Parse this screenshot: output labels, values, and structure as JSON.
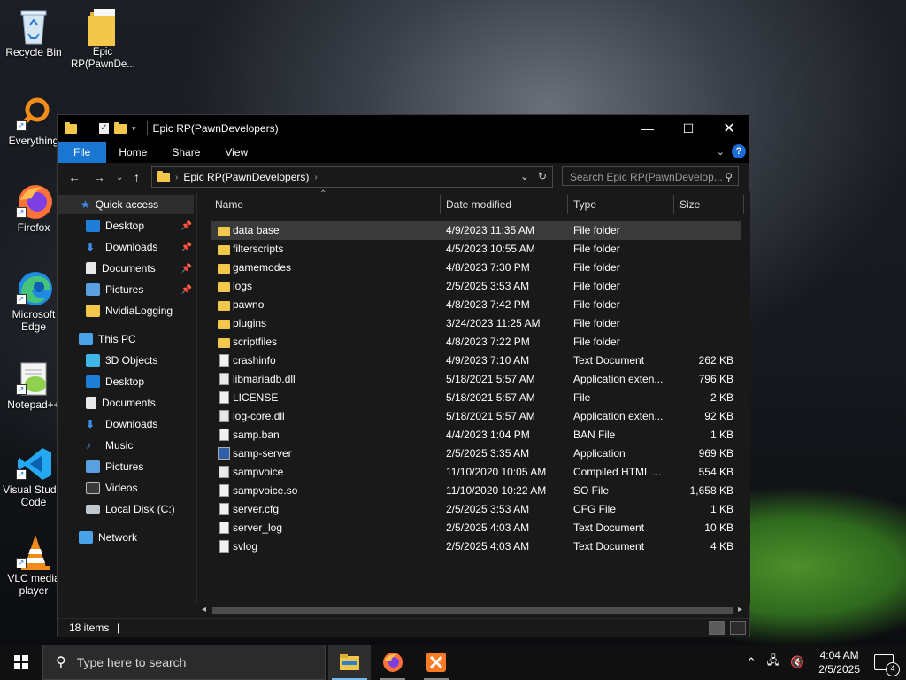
{
  "desktop": {
    "icons": [
      {
        "label": "Recycle Bin"
      },
      {
        "label": "Epic RP(PawnDe..."
      },
      {
        "label": "Everything"
      },
      {
        "label": "Firefox"
      },
      {
        "label": "Microsoft Edge"
      },
      {
        "label": "Notepad++"
      },
      {
        "label": "Visual Studio Code"
      },
      {
        "label": "VLC media player"
      }
    ]
  },
  "window": {
    "title": "Epic RP(PawnDevelopers)",
    "controls": {
      "minimize": "—",
      "maximize": "☐",
      "close": "✕"
    },
    "ribbon": {
      "file": "File",
      "home": "Home",
      "share": "Share",
      "view": "View",
      "help": "?"
    },
    "address": {
      "path": "Epic RP(PawnDevelopers)"
    },
    "search": {
      "placeholder": "Search Epic RP(PawnDevelop..."
    },
    "nav": [
      {
        "label": "Quick access",
        "pinned": false
      },
      {
        "label": "Desktop",
        "pinned": true
      },
      {
        "label": "Downloads",
        "pinned": true
      },
      {
        "label": "Documents",
        "pinned": true
      },
      {
        "label": "Pictures",
        "pinned": true
      },
      {
        "label": "NvidiaLogging",
        "pinned": false
      },
      {
        "label": "This PC",
        "pinned": false
      },
      {
        "label": "3D Objects",
        "pinned": false
      },
      {
        "label": "Desktop",
        "pinned": false
      },
      {
        "label": "Documents",
        "pinned": false
      },
      {
        "label": "Downloads",
        "pinned": false
      },
      {
        "label": "Music",
        "pinned": false
      },
      {
        "label": "Pictures",
        "pinned": false
      },
      {
        "label": "Videos",
        "pinned": false
      },
      {
        "label": "Local Disk (C:)",
        "pinned": false
      },
      {
        "label": "Network",
        "pinned": false
      }
    ],
    "columns": {
      "name": "Name",
      "date": "Date modified",
      "type": "Type",
      "size": "Size"
    },
    "files": [
      {
        "name": "data base",
        "date": "4/9/2023 11:35 AM",
        "type": "File folder",
        "size": "",
        "icon": "folder"
      },
      {
        "name": "filterscripts",
        "date": "4/5/2023 10:55 AM",
        "type": "File folder",
        "size": "",
        "icon": "folder"
      },
      {
        "name": "gamemodes",
        "date": "4/8/2023 7:30 PM",
        "type": "File folder",
        "size": "",
        "icon": "folder"
      },
      {
        "name": "logs",
        "date": "2/5/2025 3:53 AM",
        "type": "File folder",
        "size": "",
        "icon": "folder"
      },
      {
        "name": "pawno",
        "date": "4/8/2023 7:42 PM",
        "type": "File folder",
        "size": "",
        "icon": "folder"
      },
      {
        "name": "plugins",
        "date": "3/24/2023 11:25 AM",
        "type": "File folder",
        "size": "",
        "icon": "folder"
      },
      {
        "name": "scriptfiles",
        "date": "4/8/2023 7:22 PM",
        "type": "File folder",
        "size": "",
        "icon": "folder"
      },
      {
        "name": "crashinfo",
        "date": "4/9/2023 7:10 AM",
        "type": "Text Document",
        "size": "262 KB",
        "icon": "doc"
      },
      {
        "name": "libmariadb.dll",
        "date": "5/18/2021 5:57 AM",
        "type": "Application exten...",
        "size": "796 KB",
        "icon": "dll"
      },
      {
        "name": "LICENSE",
        "date": "5/18/2021 5:57 AM",
        "type": "File",
        "size": "2 KB",
        "icon": "doc"
      },
      {
        "name": "log-core.dll",
        "date": "5/18/2021 5:57 AM",
        "type": "Application exten...",
        "size": "92 KB",
        "icon": "dll"
      },
      {
        "name": "samp.ban",
        "date": "4/4/2023 1:04 PM",
        "type": "BAN File",
        "size": "1 KB",
        "icon": "doc"
      },
      {
        "name": "samp-server",
        "date": "2/5/2025 3:35 AM",
        "type": "Application",
        "size": "969 KB",
        "icon": "app"
      },
      {
        "name": "sampvoice",
        "date": "11/10/2020 10:05 AM",
        "type": "Compiled HTML ...",
        "size": "554 KB",
        "icon": "chm"
      },
      {
        "name": "sampvoice.so",
        "date": "11/10/2020 10:22 AM",
        "type": "SO File",
        "size": "1,658 KB",
        "icon": "doc"
      },
      {
        "name": "server.cfg",
        "date": "2/5/2025 3:53 AM",
        "type": "CFG File",
        "size": "1 KB",
        "icon": "doc"
      },
      {
        "name": "server_log",
        "date": "2/5/2025 4:03 AM",
        "type": "Text Document",
        "size": "10 KB",
        "icon": "doc"
      },
      {
        "name": "svlog",
        "date": "2/5/2025 4:03 AM",
        "type": "Text Document",
        "size": "4 KB",
        "icon": "doc"
      }
    ],
    "status": {
      "count": "18 items"
    }
  },
  "taskbar": {
    "search_placeholder": "Type here to search",
    "time": "4:04 AM",
    "date": "2/5/2025",
    "notifications": "4"
  }
}
